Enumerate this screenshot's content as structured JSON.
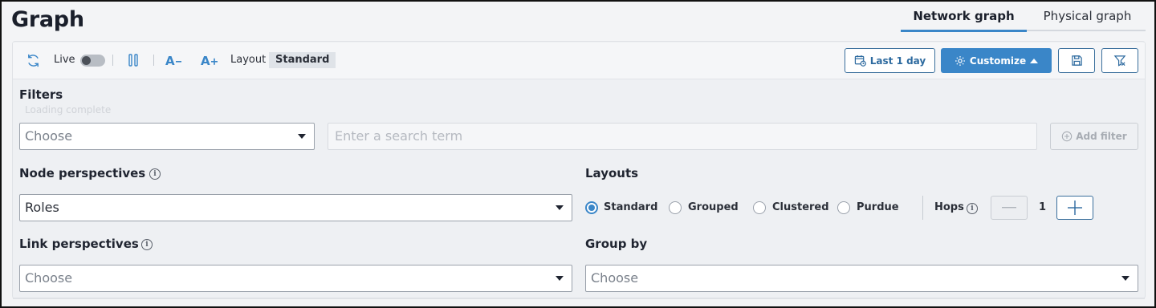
{
  "page_title": "Graph",
  "tabs": [
    {
      "label": "Network graph",
      "active": true
    },
    {
      "label": "Physical graph",
      "active": false
    }
  ],
  "toolbar": {
    "refresh_icon": "refresh-icon",
    "live_label": "Live",
    "live_on": false,
    "pause_icon": "pause-icon",
    "font_decrease_icon": "font-decrease-icon",
    "font_increase_icon": "font-increase-icon",
    "layout_label": "Layout",
    "layout_value": "Standard",
    "time_range_label": "Last 1 day",
    "customize_label": "Customize",
    "save_icon": "save-icon",
    "clear_filter_icon": "clear-filter-icon"
  },
  "filters": {
    "title": "Filters",
    "ghost_text": "Loading complete",
    "choose_placeholder": "Choose",
    "search_placeholder": "Enter a search term",
    "add_filter_label": "Add filter"
  },
  "node_perspectives": {
    "title": "Node perspectives",
    "value": "Roles"
  },
  "link_perspectives": {
    "title": "Link perspectives",
    "placeholder": "Choose"
  },
  "layouts": {
    "title": "Layouts",
    "options": [
      "Standard",
      "Grouped",
      "Clustered",
      "Purdue"
    ],
    "selected": "Standard",
    "hops_label": "Hops",
    "hops_value": "1"
  },
  "group_by": {
    "title": "Group by",
    "placeholder": "Choose"
  },
  "colors": {
    "accent": "#3a86c8",
    "text": "#1f2430",
    "panel": "#eef0f3"
  }
}
